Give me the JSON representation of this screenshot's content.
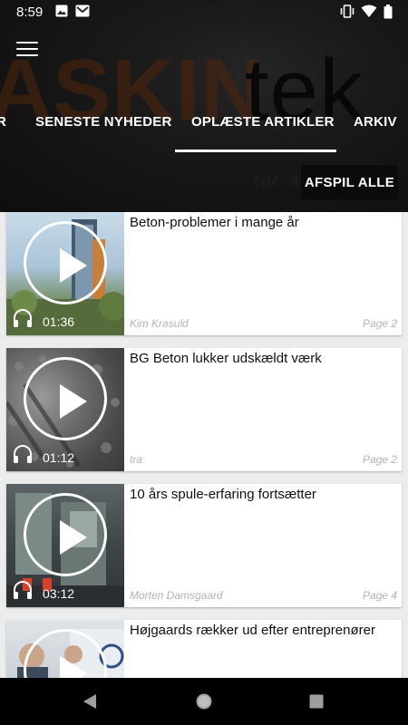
{
  "status_bar": {
    "time": "8:59"
  },
  "background": {
    "word_left": "ASKIN",
    "word_right": "tek",
    "issue_label": "NR. 4"
  },
  "tabs": [
    {
      "label": "R"
    },
    {
      "label": "SENESTE NYHEDER"
    },
    {
      "label": "OPLÆSTE ARTIKLER"
    },
    {
      "label": "ARKIV"
    }
  ],
  "play_all_label": "AFSPIL ALLE",
  "articles": [
    {
      "title": "Beton-problemer i mange år",
      "duration": "01:36",
      "author": "Kim Krasuld",
      "page": "Page 2"
    },
    {
      "title": "BG Beton lukker udskældt værk",
      "duration": "01:12",
      "author": "tra",
      "page": "Page 2"
    },
    {
      "title": "10 års spule-erfaring fortsætter",
      "duration": "03:12",
      "author": "Morten Damsgaard",
      "page": "Page 4"
    },
    {
      "title": "Højgaards rækker ud efter entreprenører",
      "duration": "",
      "author": "",
      "page": ""
    }
  ],
  "colors": {
    "header_bg": "#262626",
    "accent_bar": "#ffffff",
    "button_bg": "#0b0b0b"
  }
}
